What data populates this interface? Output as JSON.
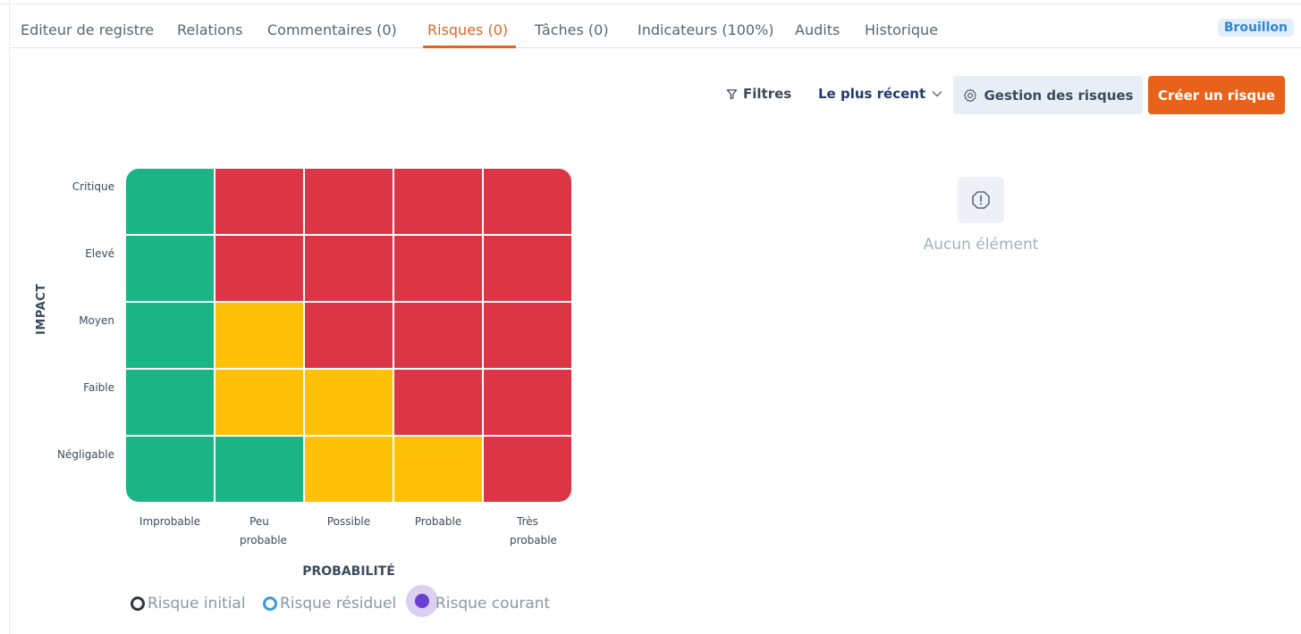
{
  "tabs": [
    {
      "label": "Editeur de registre",
      "active": false
    },
    {
      "label": "Relations",
      "active": false
    },
    {
      "label": "Commentaires (0)",
      "active": false
    },
    {
      "label": "Risques (0)",
      "active": true
    },
    {
      "label": "Tâches (0)",
      "active": false
    },
    {
      "label": "Indicateurs (100%)",
      "active": false
    },
    {
      "label": "Audits",
      "active": false
    },
    {
      "label": "Historique",
      "active": false
    }
  ],
  "status_badge": "Brouillon",
  "toolbar": {
    "filter_label": "Filtres",
    "sort_label": "Le plus récent",
    "manage_label": "Gestion des risques",
    "create_label": "Créer un risque"
  },
  "matrix": {
    "y_axis_label": "IMPACT",
    "x_axis_label": "PROBABILITÉ",
    "rows": [
      "Critique",
      "Elevé",
      "Moyen",
      "Faible",
      "Négligable"
    ],
    "columns": [
      "Improbable",
      "Peu probable",
      "Possible",
      "Probable",
      "Très probable"
    ],
    "colors": {
      "green": "#1bb585",
      "yellow": "#ffc107",
      "red": "#dc3545"
    },
    "cells": [
      [
        "green",
        "red",
        "red",
        "red",
        "red"
      ],
      [
        "green",
        "red",
        "red",
        "red",
        "red"
      ],
      [
        "green",
        "yellow",
        "red",
        "red",
        "red"
      ],
      [
        "green",
        "yellow",
        "yellow",
        "red",
        "red"
      ],
      [
        "green",
        "green",
        "yellow",
        "yellow",
        "red"
      ]
    ]
  },
  "legend": {
    "initial": "Risque initial",
    "residual": "Risque résiduel",
    "current": "Risque courant"
  },
  "empty_state": {
    "icon": "alert-octagon-icon",
    "text": "Aucun élément"
  },
  "accent_color": "#e8621b"
}
